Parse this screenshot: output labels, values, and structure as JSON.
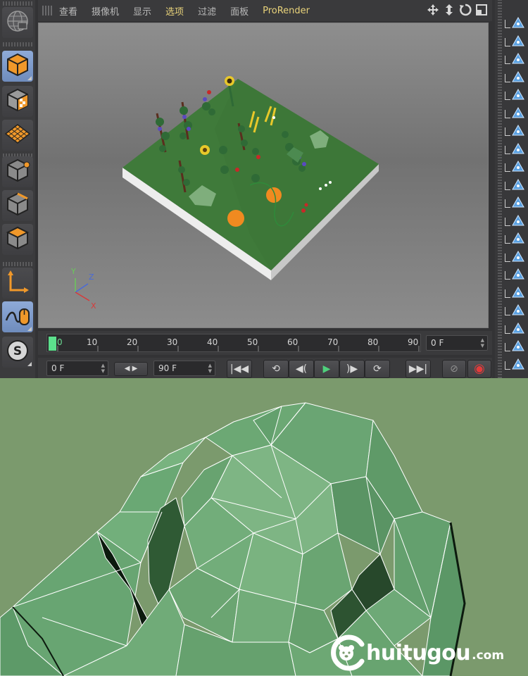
{
  "menu": {
    "items": [
      {
        "label": "查看",
        "active": false
      },
      {
        "label": "摄像机",
        "active": false
      },
      {
        "label": "显示",
        "active": false
      },
      {
        "label": "选项",
        "active": true
      },
      {
        "label": "过滤",
        "active": false
      },
      {
        "label": "面板",
        "active": false
      },
      {
        "label": "ProRender",
        "active": false
      }
    ],
    "nav_icons": [
      "move-view-icon",
      "zoom-view-icon",
      "rotate-view-icon",
      "maximize-view-icon"
    ]
  },
  "left_tools": [
    {
      "name": "world-tool",
      "icon": "globe-icon",
      "active": false
    },
    {
      "name": "model-mode",
      "icon": "cube-icon",
      "active": true
    },
    {
      "name": "texture-mode",
      "icon": "checker-cube-icon",
      "active": false
    },
    {
      "name": "workplane-mode",
      "icon": "grid-plane-icon",
      "active": false
    },
    {
      "name": "points-mode",
      "icon": "point-cube-icon",
      "active": false
    },
    {
      "name": "edges-mode",
      "icon": "edge-cube-icon",
      "active": false
    },
    {
      "name": "polygons-mode",
      "icon": "polygon-cube-icon",
      "active": false
    },
    {
      "name": "axis-mode",
      "icon": "axis-icon",
      "active": false
    },
    {
      "name": "tweak-mode",
      "icon": "mouse-icon",
      "active": true
    },
    {
      "name": "snap-tool",
      "icon": "snap-s-icon",
      "active": false
    }
  ],
  "viewport": {
    "axis_labels": {
      "x": "X",
      "y": "Y",
      "z": "Z"
    }
  },
  "timeline": {
    "ticks": [
      "0",
      "10",
      "20",
      "30",
      "40",
      "50",
      "60",
      "70",
      "80",
      "90"
    ],
    "current_frame": "0 F",
    "start_frame": "0 F",
    "end_frame": "90 F"
  },
  "transport": {
    "buttons": [
      "go-start",
      "prev-key",
      "prev-frame",
      "play",
      "next-frame",
      "next-key",
      "go-end",
      "keyframe",
      "record"
    ]
  },
  "colors": {
    "ground": "#3f7a3a",
    "accent_orange": "#f39a2b",
    "playhead": "#5ce08c",
    "closeup_bg": "#7b9a6d",
    "lettuce": "#6aa271"
  },
  "watermark": {
    "text": "huitugou",
    "suffix": ".com"
  }
}
